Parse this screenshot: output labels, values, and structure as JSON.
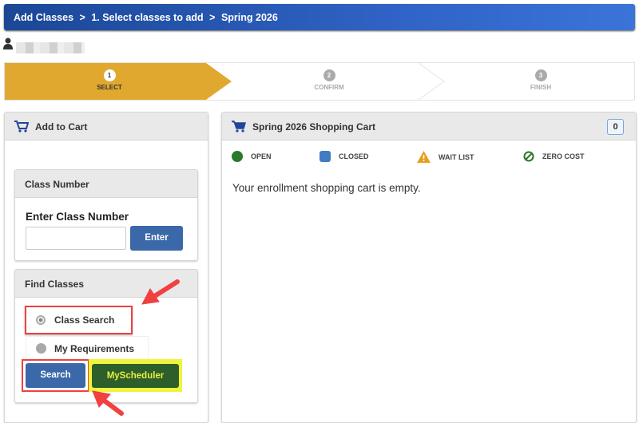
{
  "breadcrumb": [
    "Add Classes",
    "1.  Select classes to add",
    "Spring 2026"
  ],
  "breadcrumb_separator": ">",
  "steps": [
    {
      "num": "1",
      "label": "SELECT",
      "active": true
    },
    {
      "num": "2",
      "label": "CONFIRM"
    },
    {
      "num": "3",
      "label": "FINISH"
    }
  ],
  "left": {
    "title": "Add to Cart",
    "class_number": {
      "title": "Class Number",
      "prompt": "Enter Class Number",
      "input_value": "",
      "enter_label": "Enter"
    },
    "find_classes": {
      "title": "Find Classes",
      "options": [
        "Class Search",
        "My Requirements"
      ],
      "selected": "Class Search",
      "search_label": "Search",
      "scheduler_label": "MyScheduler"
    }
  },
  "cart": {
    "title": "Spring 2026 Shopping Cart",
    "count": "0",
    "legend": [
      "OPEN",
      "CLOSED",
      "WAIT LIST",
      "ZERO COST"
    ],
    "empty_text": "Your enrollment shopping cart is empty."
  },
  "colors": {
    "header": "#2f62c4",
    "step_active": "#e0a82e",
    "open": "#2a7a2a",
    "closed": "#3f7cc4",
    "wait": "#e6a020",
    "zero": "#2a7a2a",
    "primary_button": "#3a68a8",
    "scheduler_button": "#2e5e2a",
    "annotation": "#f04040",
    "highlight": "#eef53a"
  }
}
